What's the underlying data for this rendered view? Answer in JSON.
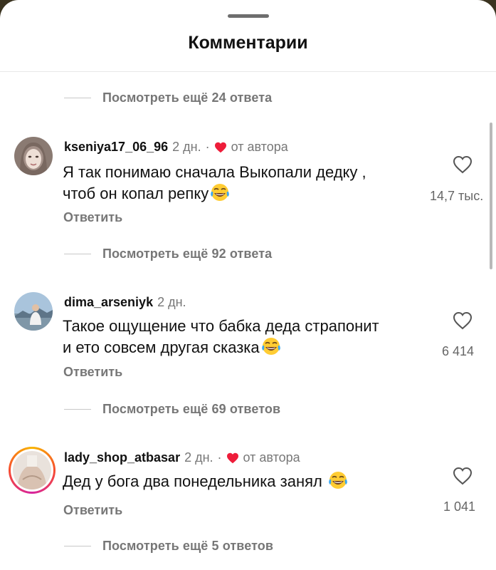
{
  "header": {
    "title": "Комментарии"
  },
  "more_replies": [
    "Посмотреть ещё 24 ответа",
    "Посмотреть ещё 92 ответа",
    "Посмотреть ещё 69 ответов",
    "Посмотреть ещё 5 ответов"
  ],
  "comments": [
    {
      "username": "kseniya17_06_96",
      "time": "2 дн.",
      "separator": "·",
      "author_label": "от автора",
      "line1": "Я так понимаю сначала Выкопали дедку ,",
      "line2": "чтоб он копал репку",
      "reply": "Ответить",
      "likes": "14,7 тыс."
    },
    {
      "username": "dima_arseniyk",
      "time": "2 дн.",
      "line1": "Такое ощущение что бабка деда страпонит",
      "line2": "и ето совсем другая сказка",
      "reply": "Ответить",
      "likes": "6 414"
    },
    {
      "username": "lady_shop_atbasar",
      "time": "2 дн.",
      "separator": "·",
      "author_label": "от автора",
      "line1": "Дед у бога два понедельника занял",
      "reply": "Ответить",
      "likes": "1 041"
    }
  ],
  "colors": {
    "author_heart": "#ee1d3a",
    "secondary_text": "#777777"
  },
  "icons": [
    "heart-outline-icon",
    "heart-filled-icon",
    "laughing-emoji-icon"
  ]
}
